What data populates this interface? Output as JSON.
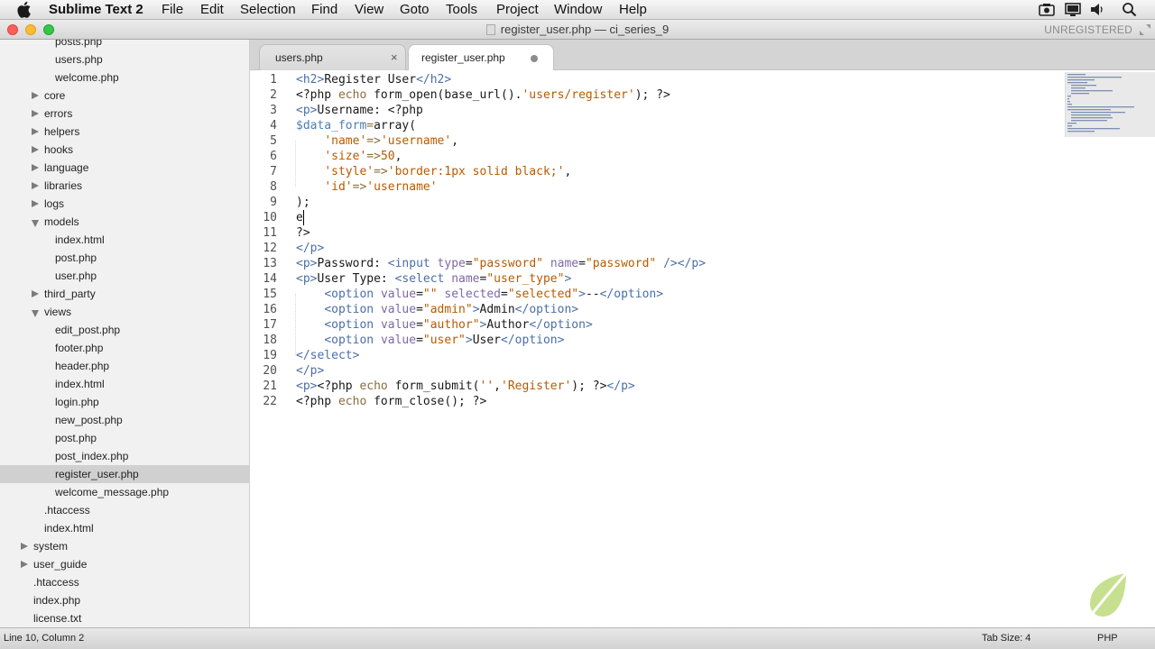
{
  "menubar": {
    "app_name": "Sublime Text 2",
    "items": [
      "File",
      "Edit",
      "Selection",
      "Find",
      "View",
      "Goto",
      "Tools",
      "Project",
      "Window",
      "Help"
    ],
    "tray_icons": [
      "screen-record-icon",
      "display-icon",
      "volume-icon",
      "search-icon"
    ]
  },
  "window": {
    "title": "register_user.php — ci_series_9",
    "license_status": "UNREGISTERED",
    "traffic_light_colors": {
      "close": "#fc5f57",
      "minimize": "#fdbc2e",
      "zoom": "#33c748"
    }
  },
  "sidebar": {
    "items": [
      {
        "label": "posts.php",
        "type": "file",
        "selected": false
      },
      {
        "label": "users.php",
        "type": "file",
        "selected": false
      },
      {
        "label": "welcome.php",
        "type": "file",
        "selected": false
      },
      {
        "label": "core",
        "type": "folder-closed",
        "selected": false
      },
      {
        "label": "errors",
        "type": "folder-closed",
        "selected": false
      },
      {
        "label": "helpers",
        "type": "folder-closed",
        "selected": false
      },
      {
        "label": "hooks",
        "type": "folder-closed",
        "selected": false
      },
      {
        "label": "language",
        "type": "folder-closed",
        "selected": false
      },
      {
        "label": "libraries",
        "type": "folder-closed",
        "selected": false
      },
      {
        "label": "logs",
        "type": "folder-closed",
        "selected": false
      },
      {
        "label": "models",
        "type": "folder-open",
        "selected": false
      },
      {
        "label": "index.html",
        "type": "file",
        "selected": false
      },
      {
        "label": "post.php",
        "type": "file",
        "selected": false
      },
      {
        "label": "user.php",
        "type": "file",
        "selected": false
      },
      {
        "label": "third_party",
        "type": "folder-closed",
        "selected": false
      },
      {
        "label": "views",
        "type": "folder-open",
        "selected": false
      },
      {
        "label": "edit_post.php",
        "type": "file",
        "selected": false
      },
      {
        "label": "footer.php",
        "type": "file",
        "selected": false
      },
      {
        "label": "header.php",
        "type": "file",
        "selected": false
      },
      {
        "label": "index.html",
        "type": "file",
        "selected": false
      },
      {
        "label": "login.php",
        "type": "file",
        "selected": false
      },
      {
        "label": "new_post.php",
        "type": "file",
        "selected": false
      },
      {
        "label": "post.php",
        "type": "file",
        "selected": false
      },
      {
        "label": "post_index.php",
        "type": "file",
        "selected": false
      },
      {
        "label": "register_user.php",
        "type": "file",
        "selected": true
      },
      {
        "label": "welcome_message.php",
        "type": "file",
        "selected": false
      },
      {
        "label": ".htaccess",
        "type": "file",
        "selected": false
      },
      {
        "label": "index.html",
        "type": "file",
        "selected": false
      },
      {
        "label": "system",
        "type": "folder-closed",
        "selected": false
      },
      {
        "label": "user_guide",
        "type": "folder-closed",
        "selected": false
      },
      {
        "label": ".htaccess",
        "type": "file",
        "selected": false
      },
      {
        "label": "index.php",
        "type": "file",
        "selected": false
      },
      {
        "label": "license.txt",
        "type": "file",
        "selected": false
      }
    ]
  },
  "tabs": [
    {
      "label": "users.php",
      "active": false,
      "modified": false
    },
    {
      "label": "register_user.php",
      "active": true,
      "modified": true
    }
  ],
  "editor": {
    "lines": [
      [
        [
          "<",
          "tag"
        ],
        [
          "h2",
          "tag"
        ],
        [
          ">",
          "tag"
        ],
        [
          "Register User",
          "text"
        ],
        [
          "</",
          "tag"
        ],
        [
          "h2",
          "tag"
        ],
        [
          ">",
          "tag"
        ]
      ],
      [
        [
          "<?php ",
          "text"
        ],
        [
          "echo",
          "kw"
        ],
        [
          " form_open(base_url().",
          "text"
        ],
        [
          "'users/register'",
          "str"
        ],
        [
          "); ?>",
          "text"
        ]
      ],
      [
        [
          "<",
          "tag"
        ],
        [
          "p",
          "tag"
        ],
        [
          ">",
          "tag"
        ],
        [
          "Username: <?php",
          "text"
        ]
      ],
      [
        [
          "$data_form",
          "var"
        ],
        [
          "=",
          "kw"
        ],
        [
          "array(",
          "text"
        ]
      ],
      [
        [
          "    ",
          "text"
        ],
        [
          "'name'",
          "str"
        ],
        [
          "=>",
          "kw"
        ],
        [
          "'username'",
          "str"
        ],
        [
          ",",
          "text"
        ]
      ],
      [
        [
          "    ",
          "text"
        ],
        [
          "'size'",
          "str"
        ],
        [
          "=>",
          "kw"
        ],
        [
          "50",
          "num"
        ],
        [
          ",",
          "text"
        ]
      ],
      [
        [
          "    ",
          "text"
        ],
        [
          "'style'",
          "str"
        ],
        [
          "=>",
          "kw"
        ],
        [
          "'border:1px solid black;'",
          "str"
        ],
        [
          ",",
          "text"
        ]
      ],
      [
        [
          "    ",
          "text"
        ],
        [
          "'id'",
          "str"
        ],
        [
          "=>",
          "kw"
        ],
        [
          "'username'",
          "str"
        ]
      ],
      [
        [
          ");",
          "text"
        ]
      ],
      [
        [
          "e",
          "text"
        ]
      ],
      [
        [
          "?>",
          "text"
        ]
      ],
      [
        [
          "</",
          "tag"
        ],
        [
          "p",
          "tag"
        ],
        [
          ">",
          "tag"
        ]
      ],
      [
        [
          "<",
          "tag"
        ],
        [
          "p",
          "tag"
        ],
        [
          ">",
          "tag"
        ],
        [
          "Password: ",
          "text"
        ],
        [
          "<",
          "tag"
        ],
        [
          "input",
          "tag"
        ],
        [
          " ",
          "text"
        ],
        [
          "type",
          "attr"
        ],
        [
          "=",
          "text"
        ],
        [
          "\"password\"",
          "str"
        ],
        [
          " ",
          "text"
        ],
        [
          "name",
          "attr"
        ],
        [
          "=",
          "text"
        ],
        [
          "\"password\"",
          "str"
        ],
        [
          " ",
          "text"
        ],
        [
          "/></",
          "tag"
        ],
        [
          "p",
          "tag"
        ],
        [
          ">",
          "tag"
        ]
      ],
      [
        [
          "<",
          "tag"
        ],
        [
          "p",
          "tag"
        ],
        [
          ">",
          "tag"
        ],
        [
          "User Type: ",
          "text"
        ],
        [
          "<",
          "tag"
        ],
        [
          "select",
          "tag"
        ],
        [
          " ",
          "text"
        ],
        [
          "name",
          "attr"
        ],
        [
          "=",
          "text"
        ],
        [
          "\"user_type\"",
          "str"
        ],
        [
          ">",
          "tag"
        ]
      ],
      [
        [
          "    ",
          "text"
        ],
        [
          "<",
          "tag"
        ],
        [
          "option",
          "tag"
        ],
        [
          " ",
          "text"
        ],
        [
          "value",
          "attr"
        ],
        [
          "=",
          "text"
        ],
        [
          "\"\"",
          "str"
        ],
        [
          " ",
          "text"
        ],
        [
          "selected",
          "attr"
        ],
        [
          "=",
          "text"
        ],
        [
          "\"selected\"",
          "str"
        ],
        [
          ">",
          "tag"
        ],
        [
          "--",
          "text"
        ],
        [
          "</",
          "tag"
        ],
        [
          "option",
          "tag"
        ],
        [
          ">",
          "tag"
        ]
      ],
      [
        [
          "    ",
          "text"
        ],
        [
          "<",
          "tag"
        ],
        [
          "option",
          "tag"
        ],
        [
          " ",
          "text"
        ],
        [
          "value",
          "attr"
        ],
        [
          "=",
          "text"
        ],
        [
          "\"admin\"",
          "str"
        ],
        [
          ">",
          "tag"
        ],
        [
          "Admin",
          "text"
        ],
        [
          "</",
          "tag"
        ],
        [
          "option",
          "tag"
        ],
        [
          ">",
          "tag"
        ]
      ],
      [
        [
          "    ",
          "text"
        ],
        [
          "<",
          "tag"
        ],
        [
          "option",
          "tag"
        ],
        [
          " ",
          "text"
        ],
        [
          "value",
          "attr"
        ],
        [
          "=",
          "text"
        ],
        [
          "\"author\"",
          "str"
        ],
        [
          ">",
          "tag"
        ],
        [
          "Author",
          "text"
        ],
        [
          "</",
          "tag"
        ],
        [
          "option",
          "tag"
        ],
        [
          ">",
          "tag"
        ]
      ],
      [
        [
          "    ",
          "text"
        ],
        [
          "<",
          "tag"
        ],
        [
          "option",
          "tag"
        ],
        [
          " ",
          "text"
        ],
        [
          "value",
          "attr"
        ],
        [
          "=",
          "text"
        ],
        [
          "\"user\"",
          "str"
        ],
        [
          ">",
          "tag"
        ],
        [
          "User",
          "text"
        ],
        [
          "</",
          "tag"
        ],
        [
          "option",
          "tag"
        ],
        [
          ">",
          "tag"
        ]
      ],
      [
        [
          "</",
          "tag"
        ],
        [
          "select",
          "tag"
        ],
        [
          ">",
          "tag"
        ]
      ],
      [
        [
          "</",
          "tag"
        ],
        [
          "p",
          "tag"
        ],
        [
          ">",
          "tag"
        ]
      ],
      [
        [
          "<",
          "tag"
        ],
        [
          "p",
          "tag"
        ],
        [
          ">",
          "tag"
        ],
        [
          "<?php ",
          "text"
        ],
        [
          "echo",
          "kw"
        ],
        [
          " form_submit(",
          "text"
        ],
        [
          "''",
          "str"
        ],
        [
          ",",
          "text"
        ],
        [
          "'Register'",
          "str"
        ],
        [
          "); ?>",
          "text"
        ],
        [
          "</",
          "tag"
        ],
        [
          "p",
          "tag"
        ],
        [
          ">",
          "tag"
        ]
      ],
      [
        [
          "<?php ",
          "text"
        ],
        [
          "echo",
          "kw"
        ],
        [
          " form_close(); ?>",
          "text"
        ]
      ]
    ],
    "cursor_line": 10,
    "colors": {
      "tag": "#4b6fa8",
      "attr": "#7b6aa6",
      "str": "#b85a00",
      "kw": "#8a6d3b",
      "var": "#4b7db8",
      "num": "#b85a00",
      "text": "#1a1a1a"
    }
  },
  "statusbar": {
    "position": "Line 10, Column 2",
    "tab_size": "Tab Size: 4",
    "syntax": "PHP"
  }
}
